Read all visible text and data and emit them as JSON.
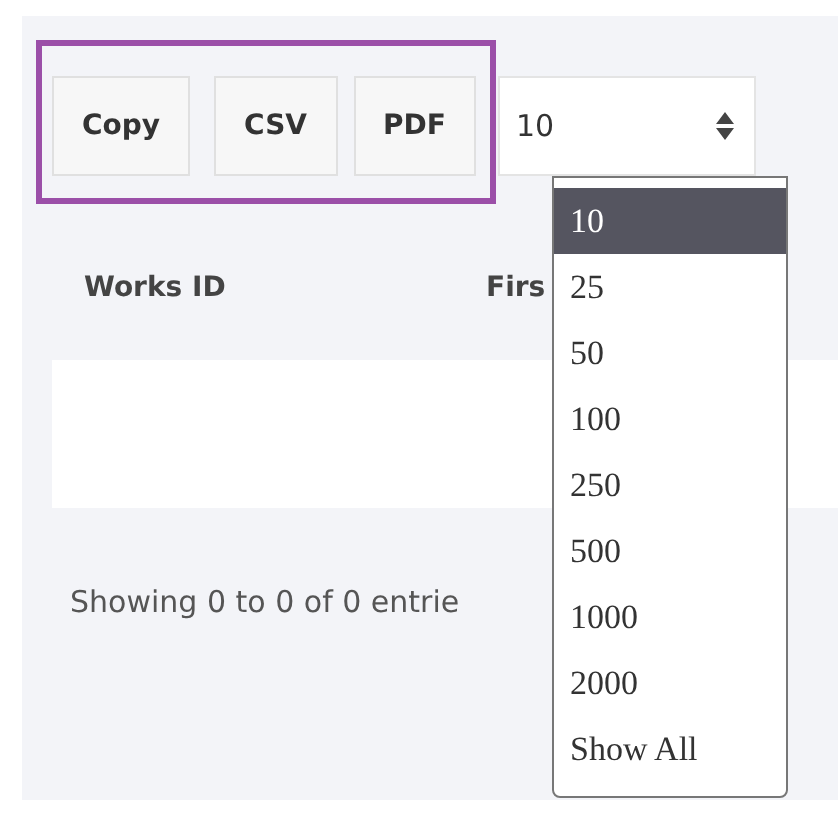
{
  "export_buttons": [
    "Copy",
    "CSV",
    "PDF"
  ],
  "page_size_select": {
    "value": "10",
    "expanded": true,
    "options": [
      {
        "label": "10",
        "selected": true
      },
      {
        "label": "25",
        "selected": false
      },
      {
        "label": "50",
        "selected": false
      },
      {
        "label": "100",
        "selected": false
      },
      {
        "label": "250",
        "selected": false
      },
      {
        "label": "500",
        "selected": false
      },
      {
        "label": "1000",
        "selected": false
      },
      {
        "label": "2000",
        "selected": false
      },
      {
        "label": "Show All",
        "selected": false
      }
    ]
  },
  "table": {
    "columns": [
      "Works ID",
      "Firs"
    ]
  },
  "info": "Showing 0 to 0 of 0 entrie"
}
